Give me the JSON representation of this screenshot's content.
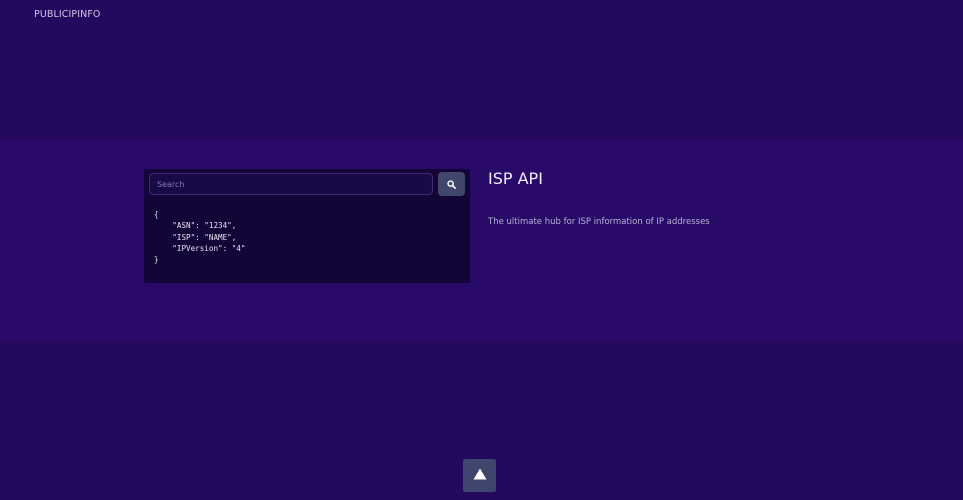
{
  "header": {
    "brand": "PUBLICIPINFO"
  },
  "search": {
    "placeholder": "Search",
    "button_icon": "search-icon"
  },
  "code_sample": {
    "open": "{",
    "lines": [
      "\"ASN\": \"1234\",",
      "\"ISP\": \"NAME\",",
      "\"IPVersion\": \"4\""
    ],
    "close": "}"
  },
  "info": {
    "title": "ISP API",
    "description": "The ultimate hub for ISP information of IP addresses"
  },
  "footer": {
    "scroll_top_icon": "triangle-up-icon"
  },
  "colors": {
    "background": "#24095f",
    "band": "#2a0a68",
    "panel": "#140538",
    "button": "#41466b"
  }
}
